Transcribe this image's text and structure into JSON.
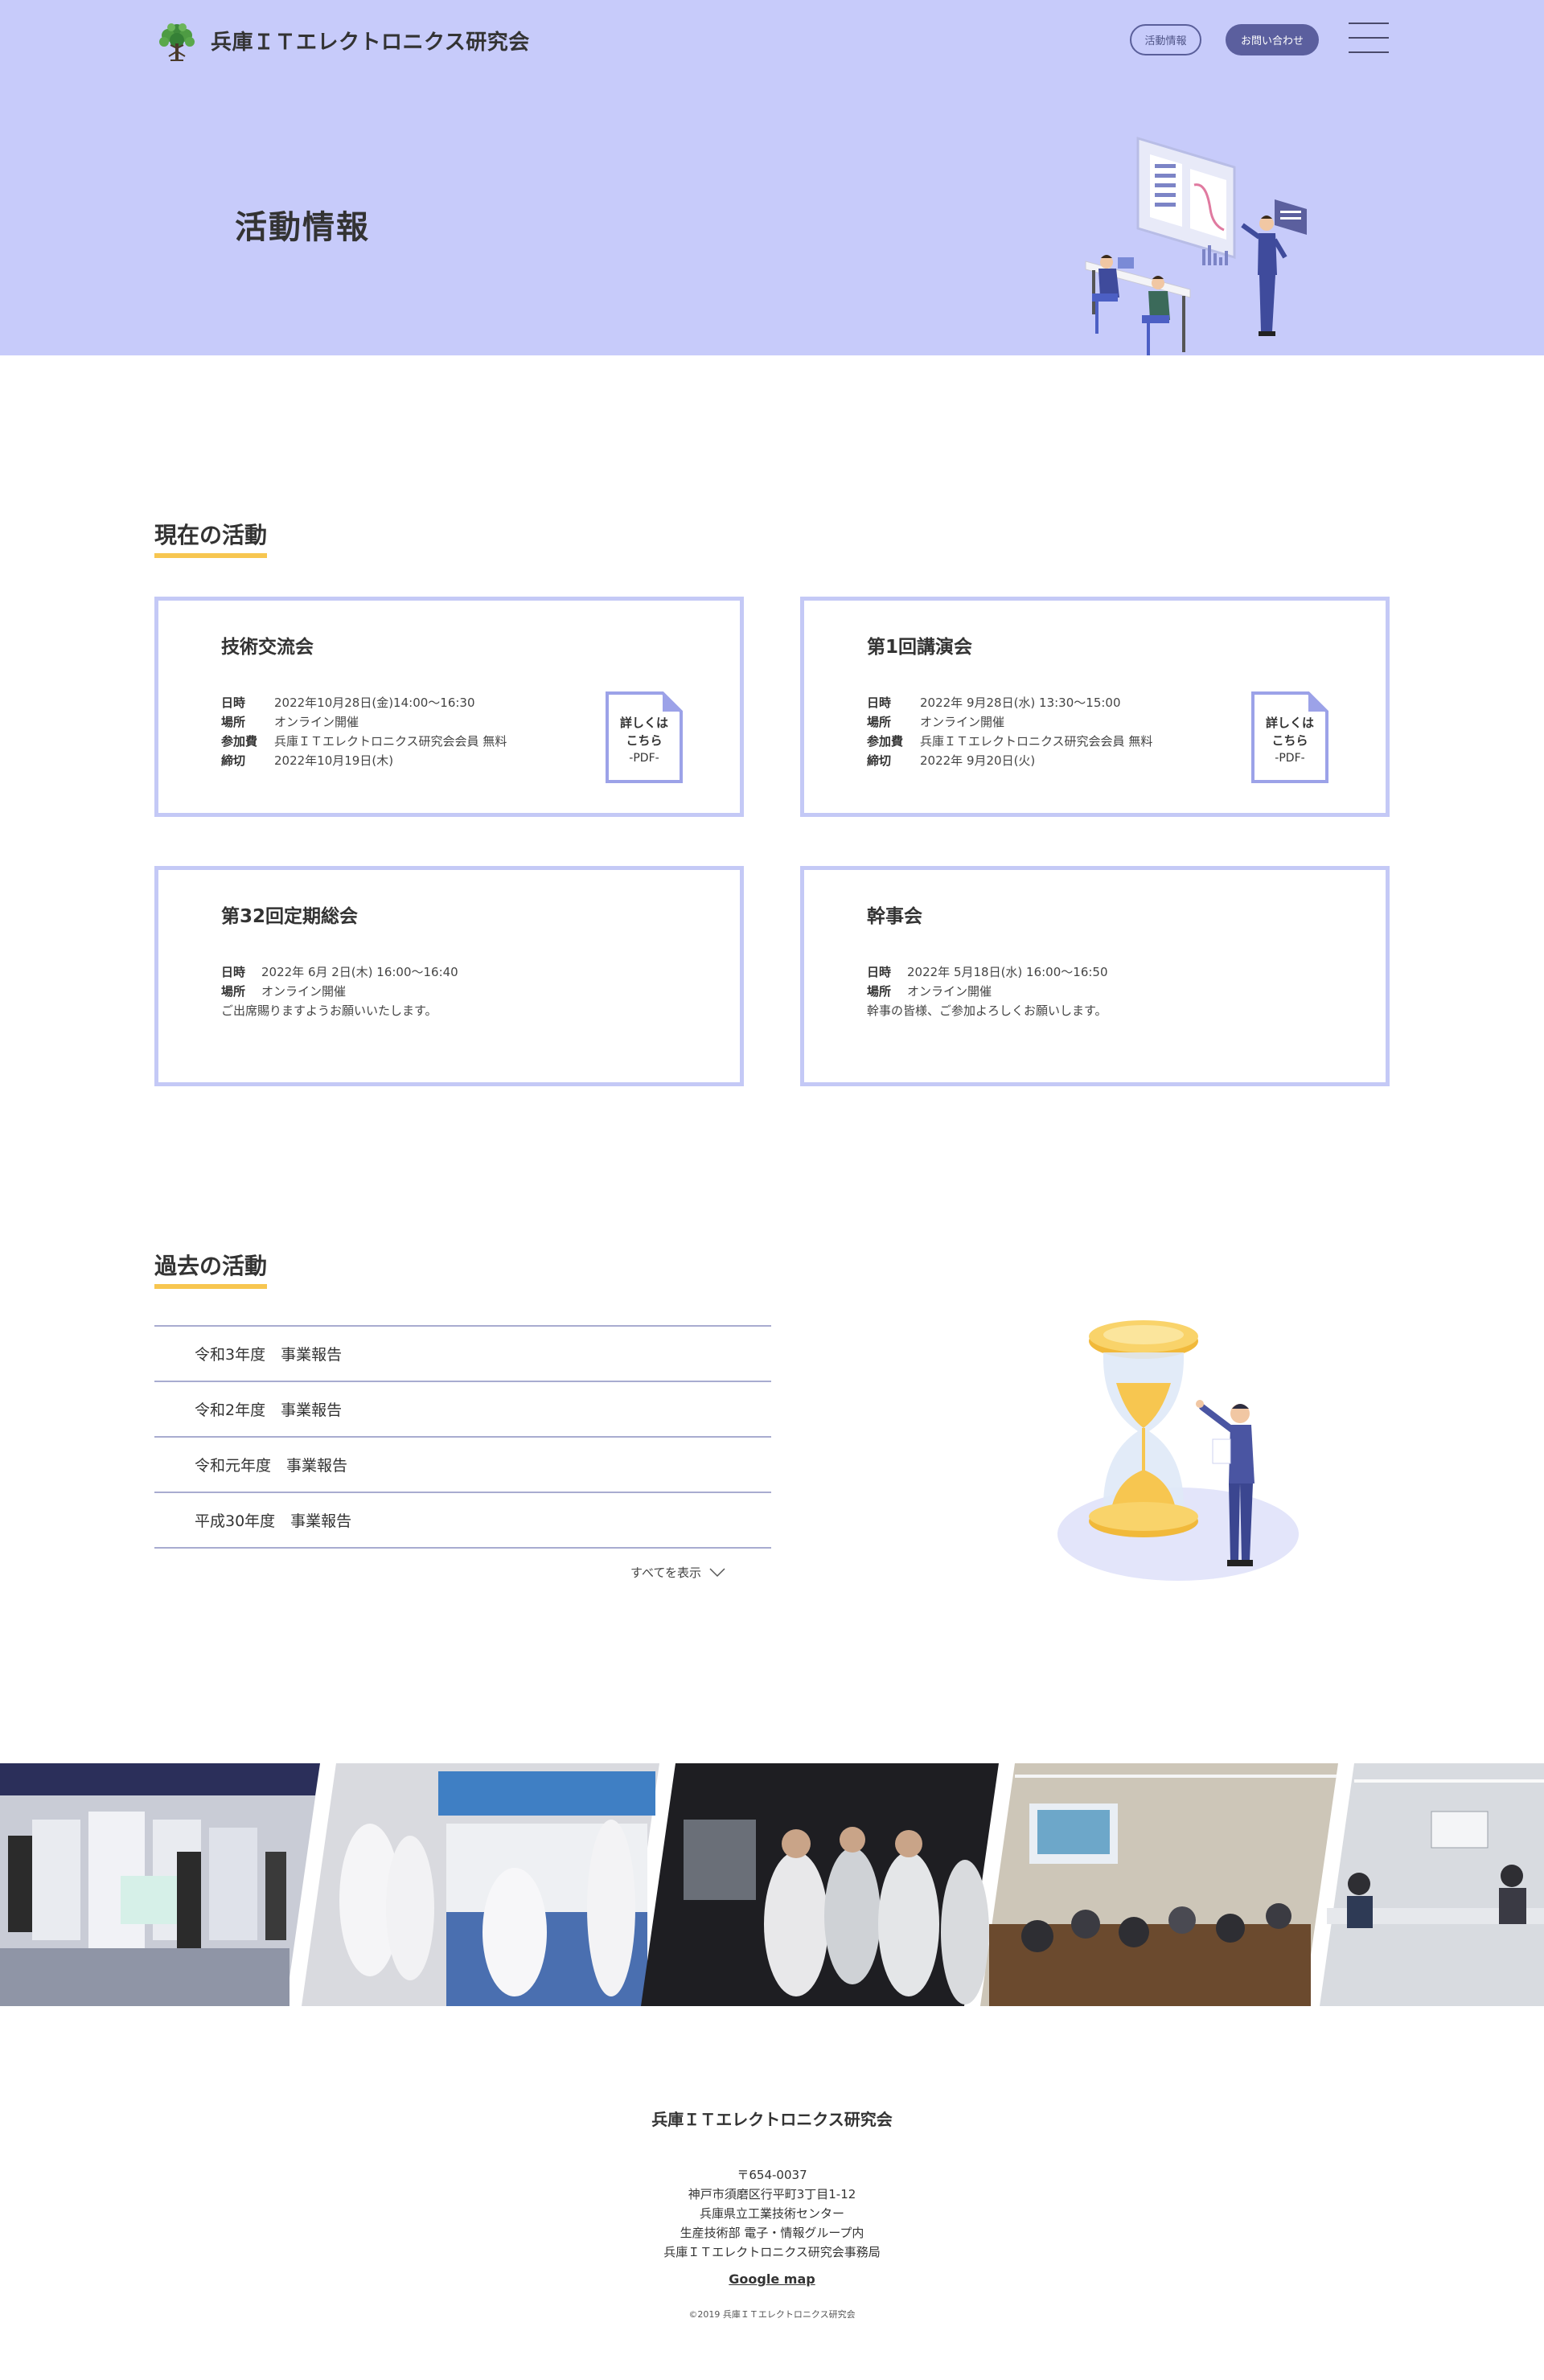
{
  "header": {
    "logo_text": "兵庫ＩＴエレクトロニクス研究会",
    "nav": {
      "activity_label": "活動情報",
      "contact_label": "お問い合わせ"
    }
  },
  "hero": {
    "title": "活動情報"
  },
  "current": {
    "heading": "現在の活動",
    "cards": [
      {
        "title": "技術交流会",
        "rows": [
          {
            "label": "日時",
            "value": "2022年10月28日(金)14:00〜16:30"
          },
          {
            "label": "場所",
            "value": "オンライン開催"
          },
          {
            "label": "参加費",
            "value": "兵庫ＩＴエレクトロニクス研究会会員 無料"
          },
          {
            "label": "締切",
            "value": "2022年10月19日(木)"
          }
        ],
        "pdf": {
          "line1": "詳しくは",
          "line2": "こちら",
          "line3": "-PDF-"
        }
      },
      {
        "title": "第1回講演会",
        "rows": [
          {
            "label": "日時",
            "value": "2022年 9月28日(水) 13:30〜15:00"
          },
          {
            "label": "場所",
            "value": "オンライン開催"
          },
          {
            "label": "参加費",
            "value": "兵庫ＩＴエレクトロニクス研究会会員 無料"
          },
          {
            "label": "締切",
            "value": "2022年 9月20日(火)"
          }
        ],
        "pdf": {
          "line1": "詳しくは",
          "line2": "こちら",
          "line3": "-PDF-"
        }
      },
      {
        "title": "第32回定期総会",
        "rows": [
          {
            "label": "日時",
            "value": "2022年 6月 2日(木) 16:00〜16:40"
          },
          {
            "label": "場所",
            "value": "オンライン開催"
          }
        ],
        "note": "ご出席賜りますようお願いいたします。"
      },
      {
        "title": "幹事会",
        "rows": [
          {
            "label": "日時",
            "value": "2022年 5月18日(水) 16:00〜16:50"
          },
          {
            "label": "場所",
            "value": "オンライン開催"
          }
        ],
        "note": "幹事の皆様、ご参加よろしくお願いします。"
      }
    ]
  },
  "past": {
    "heading": "過去の活動",
    "items": [
      "令和3年度　事業報告",
      "令和2年度　事業報告",
      "令和元年度　事業報告",
      "平成30年度　事業報告"
    ],
    "show_all": "すべてを表示"
  },
  "footer": {
    "title": "兵庫ＩＴエレクトロニクス研究会",
    "address_lines": [
      "〒654-0037",
      "神戸市須磨区行平町3丁目1-12",
      "兵庫県立工業技術センター",
      "生産技術部 電子・情報グループ内",
      "兵庫ＩＴエレクトロニクス研究会事務局"
    ],
    "map_link": "Google map",
    "copyright": "©2019 兵庫ＩＴエレクトロニクス研究会"
  },
  "colors": {
    "hero_bg": "#c7cbfa",
    "card_border": "#c4c9f6",
    "accent_underline": "#f7c650",
    "nav_filled": "#5b5f9e"
  },
  "icons": [
    "tree-logo-icon",
    "menu-icon",
    "pdf-document-icon",
    "chevron-down-icon"
  ]
}
